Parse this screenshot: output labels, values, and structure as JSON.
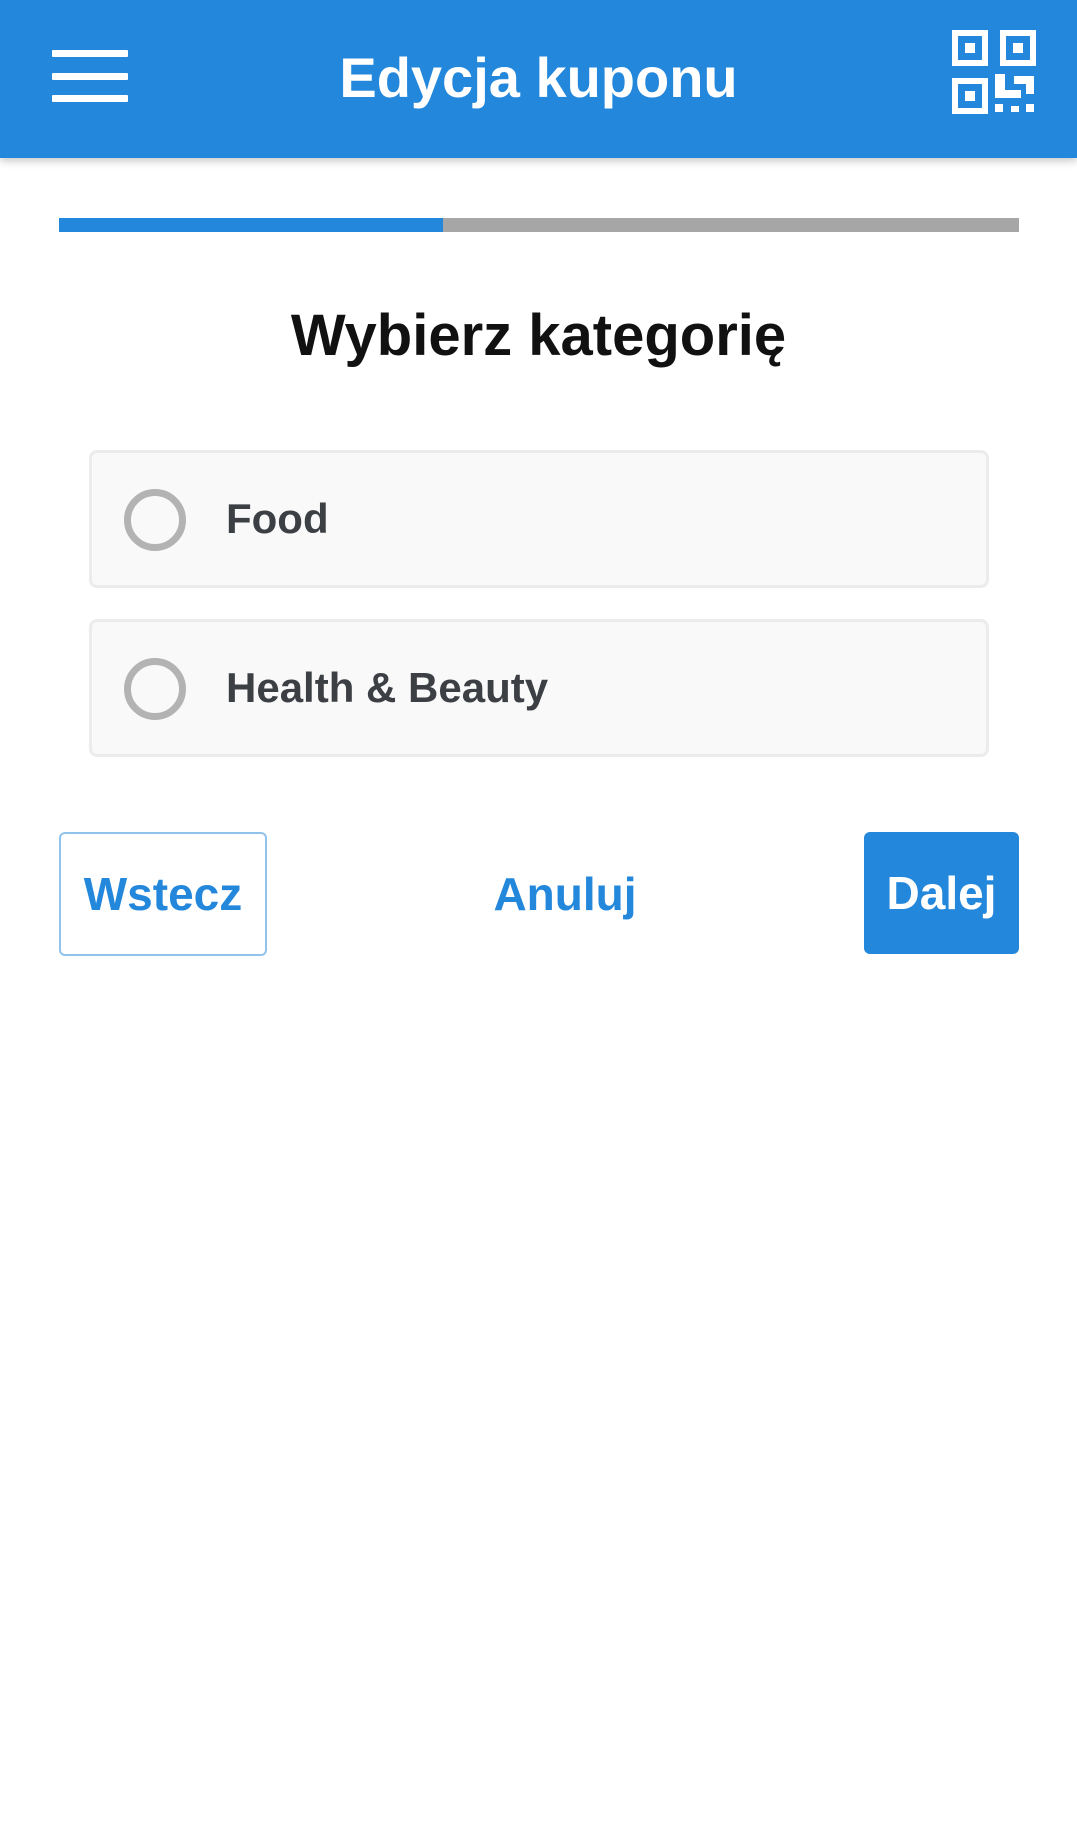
{
  "header": {
    "title": "Edycja kuponu",
    "menu_icon": "hamburger-menu-icon",
    "qr_icon": "qr-code-icon",
    "background_color": "#2387db"
  },
  "progress": {
    "fraction": 0.4,
    "fill_color": "#2387db",
    "track_color": "#a6a6a6"
  },
  "main": {
    "heading": "Wybierz kategorię",
    "options": [
      {
        "label": "Food",
        "selected": false
      },
      {
        "label": "Health & Beauty",
        "selected": false
      }
    ]
  },
  "actions": {
    "back_label": "Wstecz",
    "cancel_label": "Anuluj",
    "next_label": "Dalej"
  }
}
